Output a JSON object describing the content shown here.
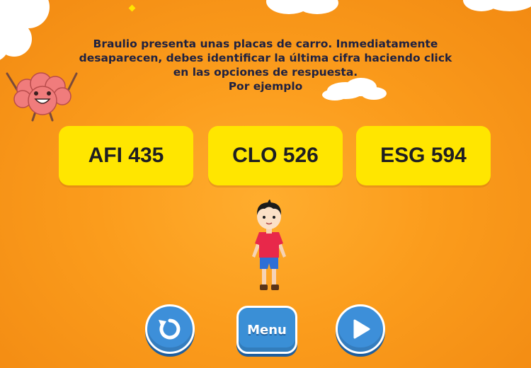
{
  "instructions": {
    "line1": "Braulio presenta unas placas de carro. Inmediatamente",
    "line2": "desaparecen, debes identificar la última cifra haciendo click",
    "line3": "en las opciones de respuesta.",
    "line4": "Por ejemplo"
  },
  "plates": [
    {
      "text": "AFI 435"
    },
    {
      "text": "CLO 526"
    },
    {
      "text": "ESG 594"
    }
  ],
  "buttons": {
    "menu_label": "Menu",
    "replay_icon": "replay-icon",
    "play_icon": "play-icon"
  },
  "colors": {
    "background": "#fb9c1c",
    "plate": "#ffe600",
    "button": "#3d8fd9",
    "text": "#1f2140"
  }
}
